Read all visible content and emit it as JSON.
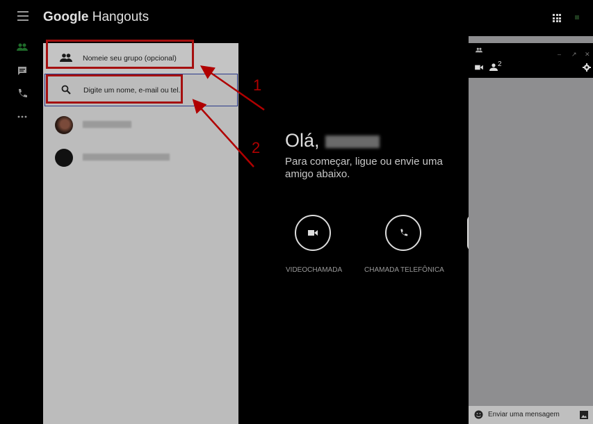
{
  "app": {
    "brand_bold": "Google",
    "brand_rest": " Hangouts"
  },
  "icons": [
    "menu-icon",
    "apps-icon",
    "people-icon",
    "chat-icon",
    "phone-icon",
    "more-icon",
    "group-icon",
    "search-icon",
    "video-icon",
    "settings-icon",
    "emoji-icon",
    "image-icon"
  ],
  "panel": {
    "group_name_placeholder": "Nomeie seu grupo (opcional)",
    "search_placeholder": "Digite um nome, e-mail ou tel."
  },
  "annotations": {
    "label1": "1",
    "label2": "2",
    "color": "#b00000"
  },
  "welcome": {
    "greeting": "Olá,",
    "line1": "Para começar, ligue ou envie uma",
    "line2": "amigo abaixo.",
    "video_label": "VIDEOCHAMADA",
    "phone_label": "CHAMADA TELEFÔNICA"
  },
  "chat": {
    "participant_count": "2",
    "message_placeholder": "Enviar uma mensagem"
  }
}
